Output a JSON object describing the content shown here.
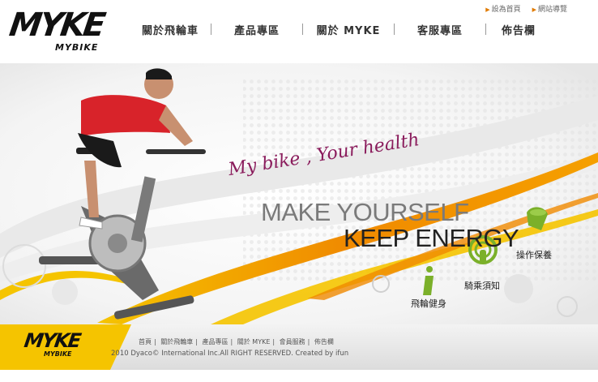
{
  "header": {
    "logo_text": "MYKE",
    "logo_sub": "MYBIKE",
    "top_links": [
      "設為首頁",
      "網站導覽"
    ],
    "nav": [
      "關於飛輪車",
      "產品專區",
      "關於 MYKE",
      "客服專區",
      "佈告欄"
    ]
  },
  "hero": {
    "script_tagline": "My bike , Your health",
    "headline1": "MAKE YOURSELF",
    "headline2": "KEEP ENERGY",
    "buttons": {
      "fitness": "飛輪健身",
      "riding": "騎乘須知",
      "care": "操作保養"
    },
    "colors": {
      "orange": "#f08a00",
      "yellow": "#f5c400",
      "green": "#7bb02a",
      "jersey_red": "#d8232a"
    }
  },
  "footer": {
    "logo_text": "MYKE",
    "logo_sub": "MYBIKE",
    "links": [
      "首頁",
      "關於飛輪車",
      "產品專區",
      "關於 MYKE",
      "會員服務",
      "佈告欄"
    ],
    "copyright": "2010 Dyaco© International Inc.All RIGHT RESERVED. Created by ifun"
  }
}
